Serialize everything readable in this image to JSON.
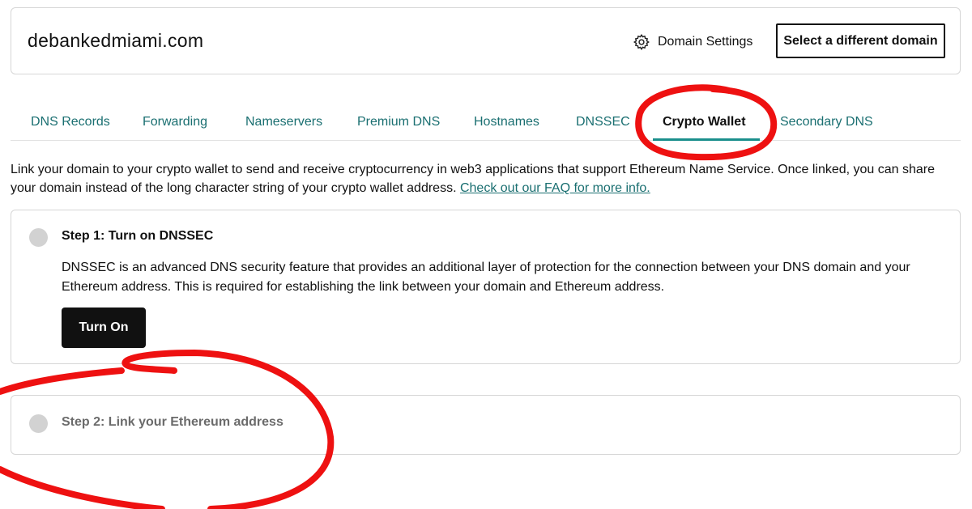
{
  "header": {
    "domain": "debankedmiami.com",
    "settings_label": "Domain Settings",
    "settings_icon": "gear-icon",
    "select_domain_label": "Select a different domain"
  },
  "tabs": [
    {
      "label": "DNS Records",
      "active": false
    },
    {
      "label": "Forwarding",
      "active": false
    },
    {
      "label": "Nameservers",
      "active": false
    },
    {
      "label": "Premium DNS",
      "active": false
    },
    {
      "label": "Hostnames",
      "active": false
    },
    {
      "label": "DNSSEC",
      "active": false
    },
    {
      "label": "Crypto Wallet",
      "active": true
    },
    {
      "label": "Secondary DNS",
      "active": false
    }
  ],
  "intro": {
    "text": "Link your domain to your crypto wallet to send and receive cryptocurrency in web3 applications that support Ethereum Name Service. Once linked, you can share your domain instead of the long character string of your crypto wallet address.",
    "link_text": "Check out our FAQ for more info."
  },
  "steps": [
    {
      "title": "Step 1: Turn on DNSSEC",
      "description": "DNSSEC is an advanced DNS security feature that provides an additional layer of protection for the connection between your DNS domain and your Ethereum address. This is required for establishing the link between your domain and Ethereum address.",
      "button_label": "Turn On"
    },
    {
      "title": "Step 2: Link your Ethereum address"
    }
  ],
  "colors": {
    "accent_teal": "#1a6f71",
    "tab_underline": "#1a8f8c",
    "annotation_red": "#ee1111",
    "step_dot": "#d2d2d2"
  }
}
